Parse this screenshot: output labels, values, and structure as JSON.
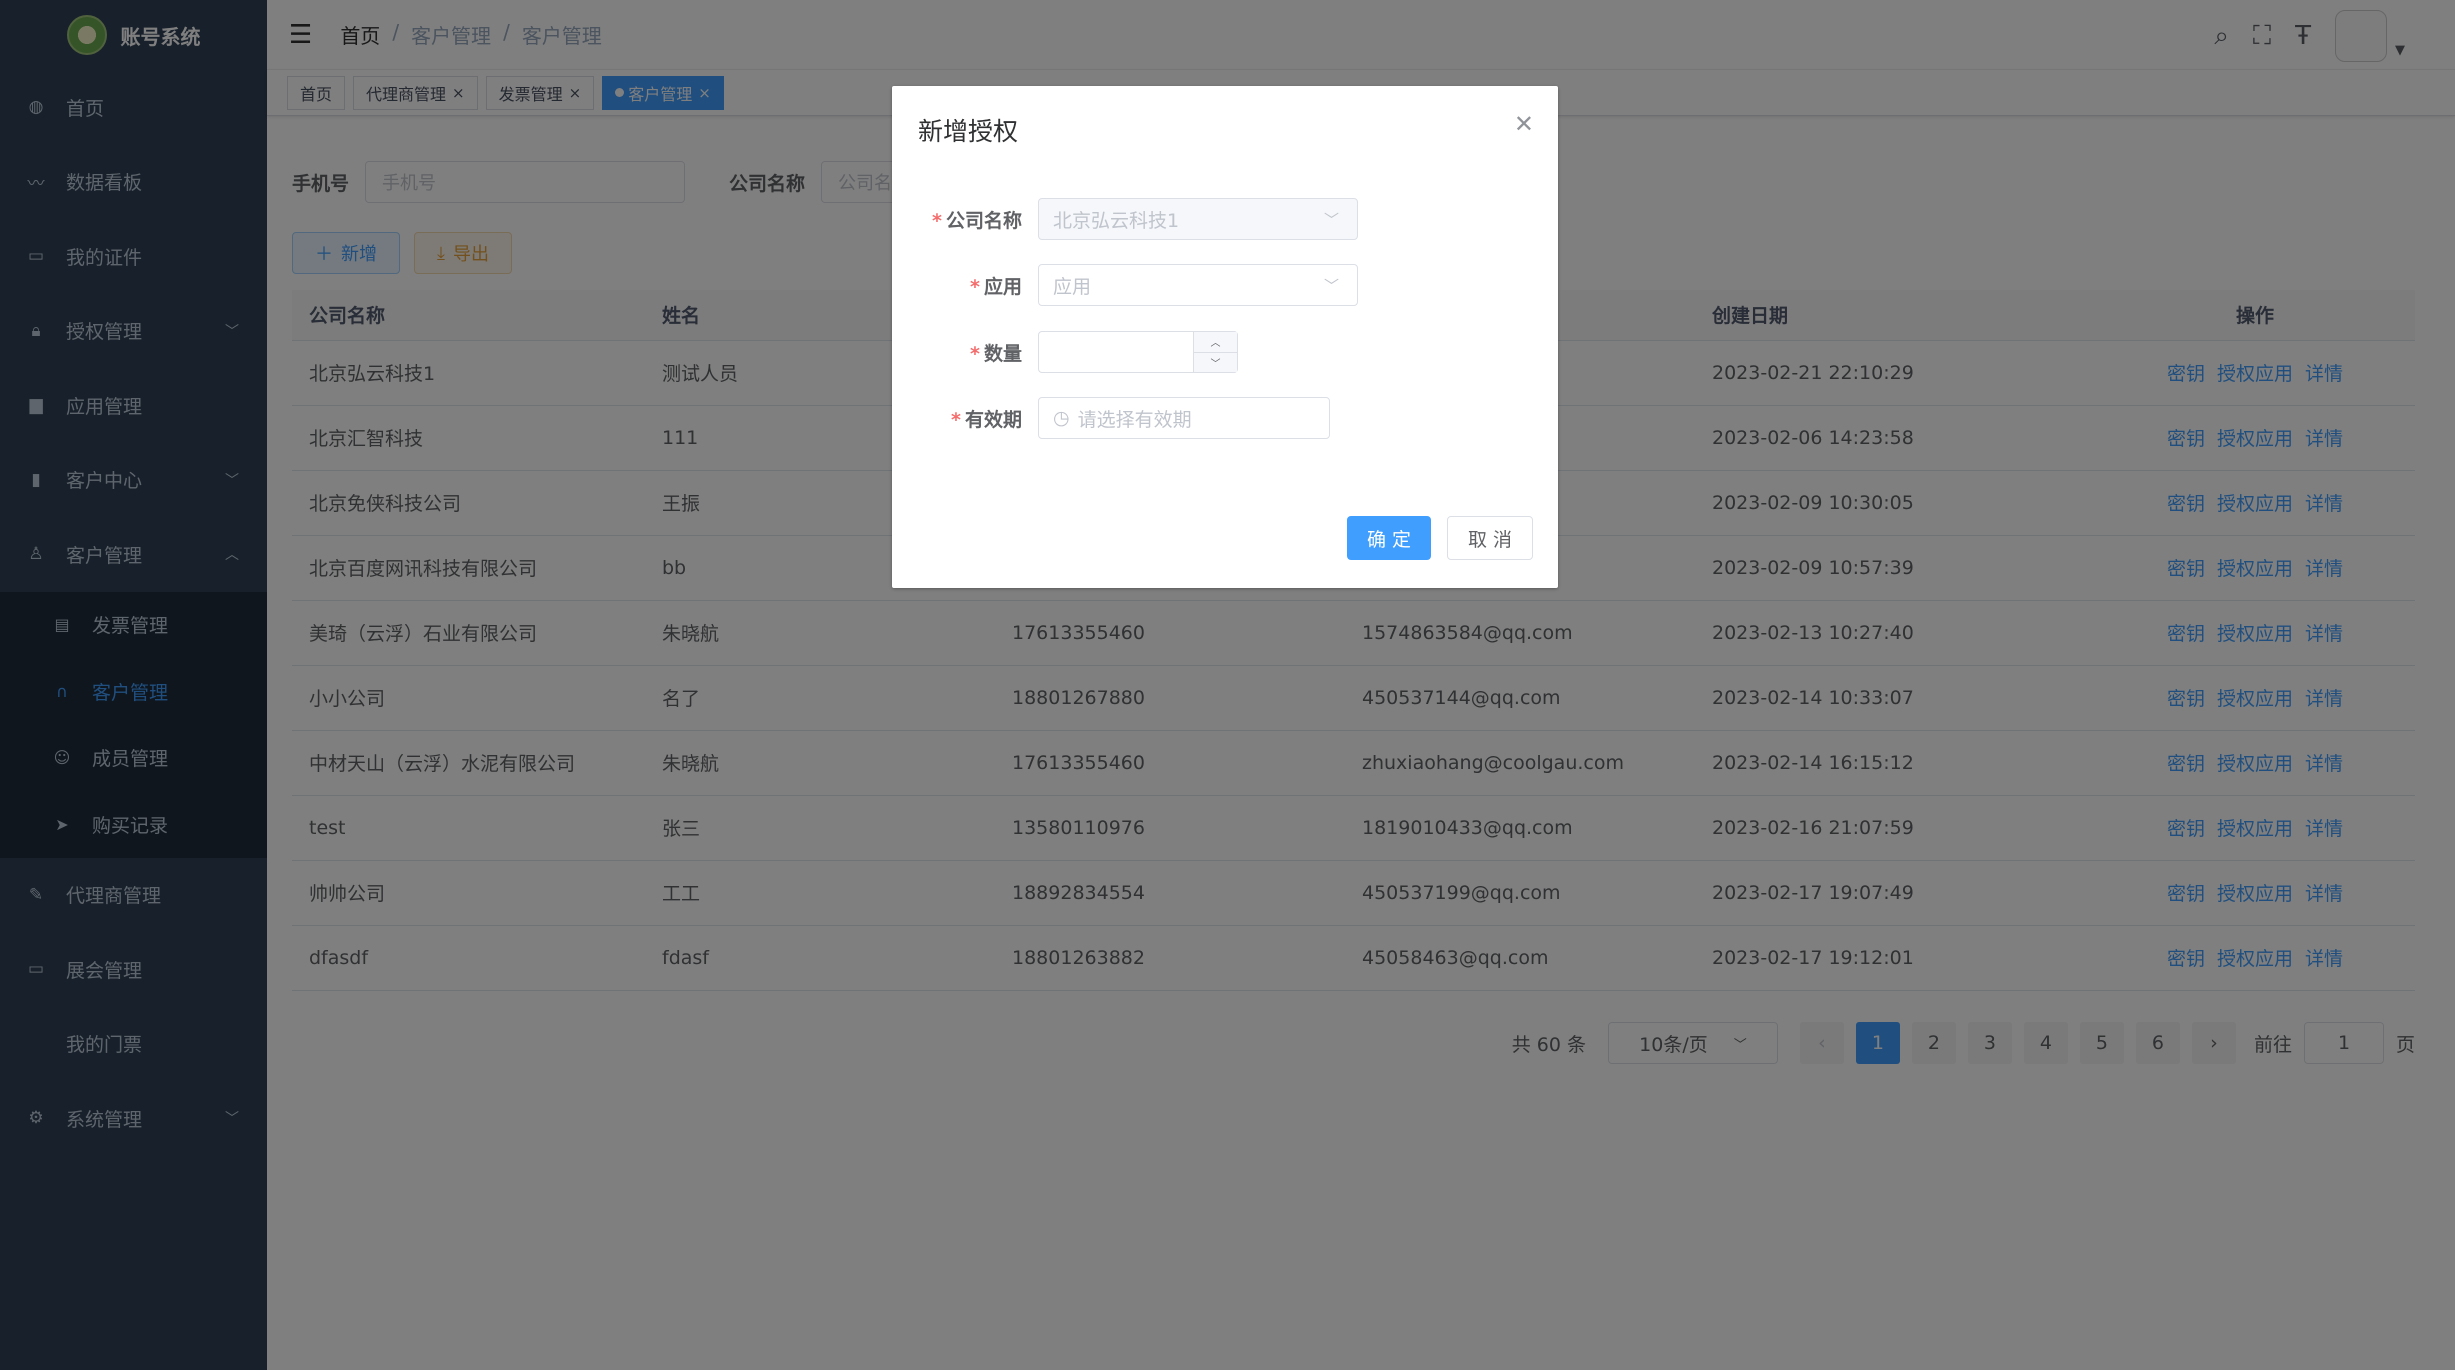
{
  "sidebar": {
    "logo_text": "账号系统",
    "items": [
      {
        "label": "首页",
        "icon": "dashboard-icon"
      },
      {
        "label": "数据看板",
        "icon": "chart-icon"
      },
      {
        "label": "我的证件",
        "icon": "card-icon"
      },
      {
        "label": "授权管理",
        "icon": "lock-icon"
      },
      {
        "label": "应用管理",
        "icon": "app-icon"
      },
      {
        "label": "客户中心",
        "icon": "bar-icon"
      },
      {
        "label": "客户管理",
        "icon": "user-icon"
      }
    ],
    "sub_items": [
      {
        "label": "发票管理",
        "icon": "document-icon"
      },
      {
        "label": "客户管理",
        "icon": "headset-icon"
      },
      {
        "label": "成员管理",
        "icon": "member-icon"
      },
      {
        "label": "购买记录",
        "icon": "send-icon"
      }
    ],
    "items2": [
      {
        "label": "代理商管理",
        "icon": "edit-icon"
      },
      {
        "label": "展会管理",
        "icon": "monitor-icon"
      },
      {
        "label": "我的门票",
        "icon": ""
      },
      {
        "label": "系统管理",
        "icon": "gear-icon"
      }
    ]
  },
  "header": {
    "breadcrumb": [
      "首页",
      "客户管理",
      "客户管理"
    ],
    "separator": "/"
  },
  "tags": [
    "首页",
    "代理商管理",
    "发票管理",
    "客户管理"
  ],
  "search": {
    "phone_label": "手机号",
    "phone_placeholder": "手机号",
    "company_label": "公司名称",
    "company_placeholder": "公司名称"
  },
  "buttons": {
    "add": "新增",
    "export": "导出"
  },
  "table": {
    "headers": [
      "公司名称",
      "姓名",
      "",
      "",
      "创建日期",
      "操作"
    ],
    "actions": [
      "密钥",
      "授权应用",
      "详情"
    ],
    "rows": [
      [
        "北京弘云科技1",
        "测试人员",
        "",
        "",
        "2023-02-21 22:10:29"
      ],
      [
        "北京汇智科技",
        "111",
        "",
        "",
        "2023-02-06 14:23:58"
      ],
      [
        "北京免侠科技公司",
        "王振",
        "",
        "",
        "2023-02-09 10:30:05"
      ],
      [
        "北京百度网讯科技有限公司",
        "bb",
        "",
        "",
        "2023-02-09 10:57:39"
      ],
      [
        "美琦（云浮）石业有限公司",
        "朱晓航",
        "17613355460",
        "1574863584@qq.com",
        "2023-02-13 10:27:40"
      ],
      [
        "小小公司",
        "名了",
        "18801267880",
        "450537144@qq.com",
        "2023-02-14 10:33:07"
      ],
      [
        "中材天山（云浮）水泥有限公司",
        "朱晓航",
        "17613355460",
        "zhuxiaohang@coolgau.com",
        "2023-02-14 16:15:12"
      ],
      [
        "test",
        "张三",
        "13580110976",
        "1819010433@qq.com",
        "2023-02-16 21:07:59"
      ],
      [
        "帅帅公司",
        "工工",
        "18892834554",
        "450537199@qq.com",
        "2023-02-17 19:07:49"
      ],
      [
        "dfasdf",
        "fdasf",
        "18801263882",
        "45058463@qq.com",
        "2023-02-17 19:12:01"
      ]
    ]
  },
  "pagination": {
    "total": "共 60 条",
    "size": "10条/页",
    "pages": [
      "1",
      "2",
      "3",
      "4",
      "5",
      "6"
    ],
    "current": "1",
    "goto_label": "前往",
    "goto_value": "1",
    "page_suffix": "页"
  },
  "dialog": {
    "title": "新增授权",
    "company_label": "公司名称",
    "company_value": "北京弘云科技1",
    "app_label": "应用",
    "app_placeholder": "应用",
    "qty_label": "数量",
    "validity_label": "有效期",
    "validity_placeholder": "请选择有效期",
    "ok": "确 定",
    "cancel": "取 消"
  }
}
